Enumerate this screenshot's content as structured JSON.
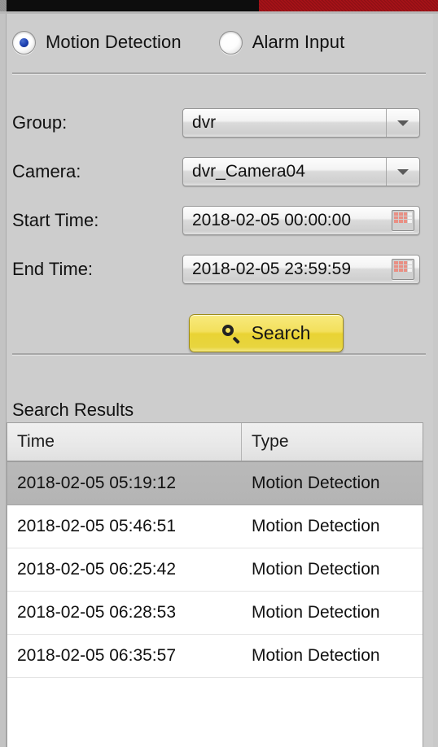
{
  "window": {
    "title_strip_colors": {
      "black": "#0d0d0d",
      "red": "#a81218"
    }
  },
  "event_type": {
    "options": [
      {
        "label": "Motion Detection",
        "selected": true
      },
      {
        "label": "Alarm Input",
        "selected": false
      }
    ]
  },
  "form": {
    "group": {
      "label": "Group:",
      "value": "dvr",
      "icon": "chevron-down-icon"
    },
    "camera": {
      "label": "Camera:",
      "value": "dvr_Camera04",
      "icon": "chevron-down-icon"
    },
    "start_time": {
      "label": "Start Time:",
      "value": "2018-02-05 00:00:00",
      "icon": "calendar-icon"
    },
    "end_time": {
      "label": "End Time:",
      "value": "2018-02-05 23:59:59",
      "icon": "calendar-icon"
    }
  },
  "search_button": {
    "label": "Search",
    "icon": "magnifier-icon",
    "color": "#e9d334"
  },
  "results": {
    "title": "Search Results",
    "columns": [
      "Time",
      "Type"
    ],
    "rows": [
      {
        "time": "2018-02-05 05:19:12",
        "type": "Motion Detection",
        "selected": true
      },
      {
        "time": "2018-02-05 05:46:51",
        "type": "Motion Detection",
        "selected": false
      },
      {
        "time": "2018-02-05 06:25:42",
        "type": "Motion Detection",
        "selected": false
      },
      {
        "time": "2018-02-05 06:28:53",
        "type": "Motion Detection",
        "selected": false
      },
      {
        "time": "2018-02-05 06:35:57",
        "type": "Motion Detection",
        "selected": false
      }
    ]
  }
}
